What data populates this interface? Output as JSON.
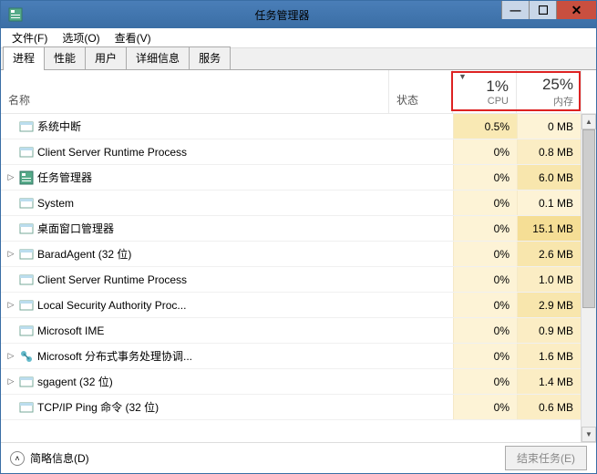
{
  "window": {
    "title": "任务管理器"
  },
  "menu": {
    "file": "文件(F)",
    "options": "选项(O)",
    "view": "查看(V)"
  },
  "tabs": {
    "processes": "进程",
    "performance": "性能",
    "users": "用户",
    "details": "详细信息",
    "services": "服务"
  },
  "headers": {
    "name": "名称",
    "status": "状态",
    "cpu_pct": "1%",
    "cpu_lbl": "CPU",
    "mem_pct": "25%",
    "mem_lbl": "内存"
  },
  "processes": [
    {
      "name": "系统中断",
      "cpu": "0.5%",
      "mem": "0 MB",
      "expandable": false,
      "icon": "app",
      "cpu_high": true,
      "mem_lvl": 0
    },
    {
      "name": "Client Server Runtime Process",
      "cpu": "0%",
      "mem": "0.8 MB",
      "expandable": false,
      "icon": "app",
      "mem_lvl": 1
    },
    {
      "name": "任务管理器",
      "cpu": "0%",
      "mem": "6.0 MB",
      "expandable": true,
      "icon": "task",
      "mem_lvl": 2
    },
    {
      "name": "System",
      "cpu": "0%",
      "mem": "0.1 MB",
      "expandable": false,
      "icon": "app",
      "mem_lvl": 0
    },
    {
      "name": "桌面窗口管理器",
      "cpu": "0%",
      "mem": "15.1 MB",
      "expandable": false,
      "icon": "app",
      "mem_lvl": 3
    },
    {
      "name": "BaradAgent (32 位)",
      "cpu": "0%",
      "mem": "2.6 MB",
      "expandable": true,
      "icon": "app",
      "mem_lvl": 2
    },
    {
      "name": "Client Server Runtime Process",
      "cpu": "0%",
      "mem": "1.0 MB",
      "expandable": false,
      "icon": "app",
      "mem_lvl": 1
    },
    {
      "name": "Local Security Authority Proc...",
      "cpu": "0%",
      "mem": "2.9 MB",
      "expandable": true,
      "icon": "app",
      "mem_lvl": 2
    },
    {
      "name": "Microsoft IME",
      "cpu": "0%",
      "mem": "0.9 MB",
      "expandable": false,
      "icon": "app",
      "mem_lvl": 1
    },
    {
      "name": "Microsoft 分布式事务处理协调...",
      "cpu": "0%",
      "mem": "1.6 MB",
      "expandable": true,
      "icon": "dtc",
      "mem_lvl": 1
    },
    {
      "name": "sgagent (32 位)",
      "cpu": "0%",
      "mem": "1.4 MB",
      "expandable": true,
      "icon": "app",
      "mem_lvl": 1
    },
    {
      "name": "TCP/IP Ping 命令 (32 位)",
      "cpu": "0%",
      "mem": "0.6 MB",
      "expandable": false,
      "icon": "app",
      "mem_lvl": 1
    }
  ],
  "footer": {
    "fewer": "简略信息(D)",
    "end_task": "结束任务(E)"
  }
}
